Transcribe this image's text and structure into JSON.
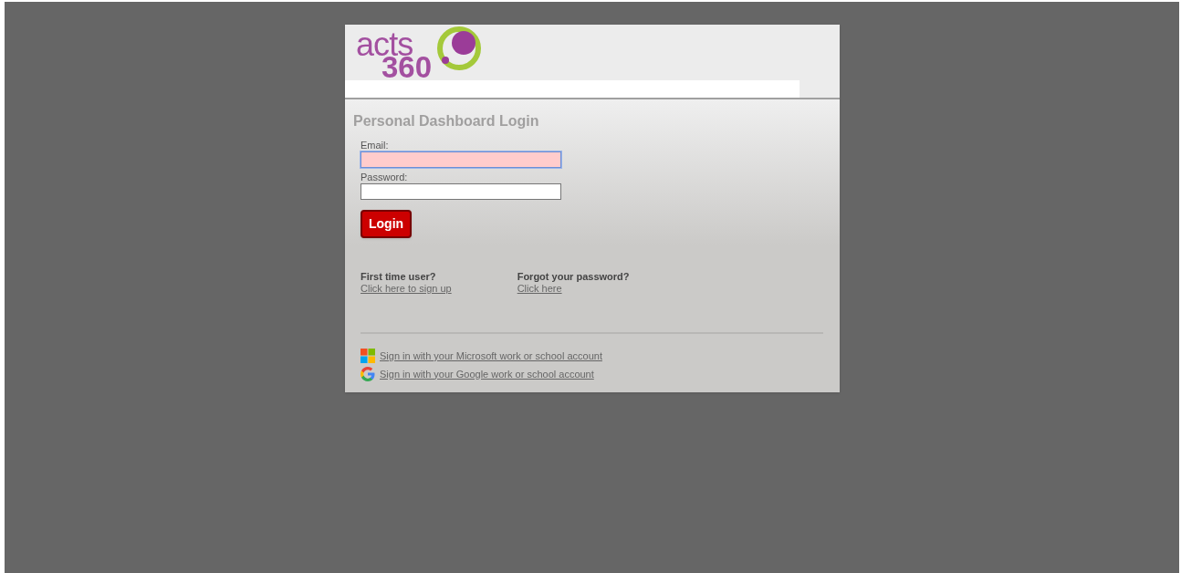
{
  "logo": {
    "word": "acts",
    "number": "360"
  },
  "title": "Personal Dashboard Login",
  "fields": [
    {
      "label": "Email:",
      "invalid": true,
      "focused": true
    },
    {
      "label": "Password:",
      "invalid": false,
      "focused": false
    }
  ],
  "login_button": "Login",
  "help": [
    {
      "question": "First time user?",
      "link": "Click here to sign up"
    },
    {
      "question": "Forgot your password?",
      "link": "Click here"
    }
  ],
  "sso": [
    {
      "kind": "microsoft",
      "link": "Sign in with your Microsoft work or school account"
    },
    {
      "kind": "google",
      "link": "Sign in with your Google work or school account"
    }
  ]
}
